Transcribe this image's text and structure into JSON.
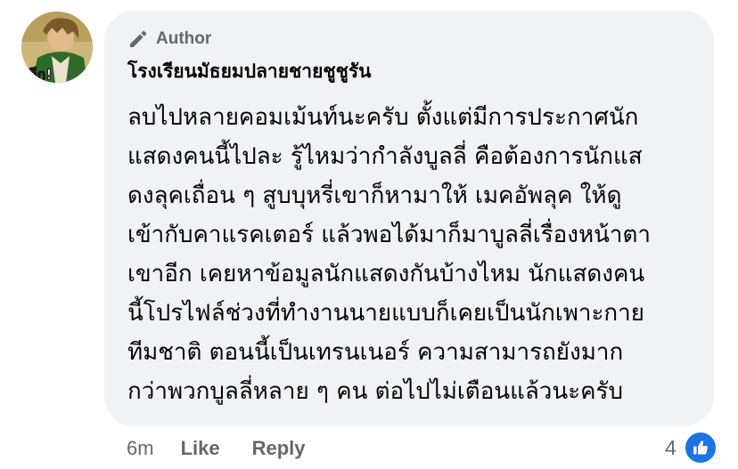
{
  "author_badge": {
    "label": "Author",
    "icon": "pencil-icon"
  },
  "comment": {
    "author_name": "โรงเรียนมัธยมปลายชายชูชูรัน",
    "lines": [
      "ลบไปหลายคอมเม้นท์นะครับ ตั้งแต่มีการประกาศนัก",
      "แสดงคนนี้ไปละ รู้ไหมว่ากำลังบูลลี่ คือต้องการนักแส",
      "ดงลุคเถื่อน ๆ สูบบุหรี่เขาก็หามาให้ เมคอัพลุค ให้ดู",
      "เข้ากับคาแรคเตอร์ แล้วพอได้มาก็มาบูลลี่เรื่องหน้าตา",
      "เขาอีก เคยหาข้อมูลนักแสดงกันบ้างไหม นักแสดงคน",
      "นี้โปรไฟล์ช่วงที่ทำงานนายแบบก็เคยเป็นนักเพาะกาย",
      "ทีมชาติ ตอนนี้เป็นเทรนเนอร์ ความสามารถยังมาก",
      "กว่าพวกบูลลี่หลาย ๆ คน ต่อไปไม่เตือนแล้วนะครับ"
    ]
  },
  "avatar": {
    "text": "อีก!"
  },
  "actions": {
    "time": "6m",
    "like": "Like",
    "reply": "Reply"
  },
  "reactions": {
    "count": "4",
    "icon": "thumbs-up-icon"
  },
  "colors": {
    "bubble": "#f0f2f5",
    "secondary_text": "#65676b",
    "primary_text": "#050505",
    "like_blue": "#1b74e4"
  }
}
